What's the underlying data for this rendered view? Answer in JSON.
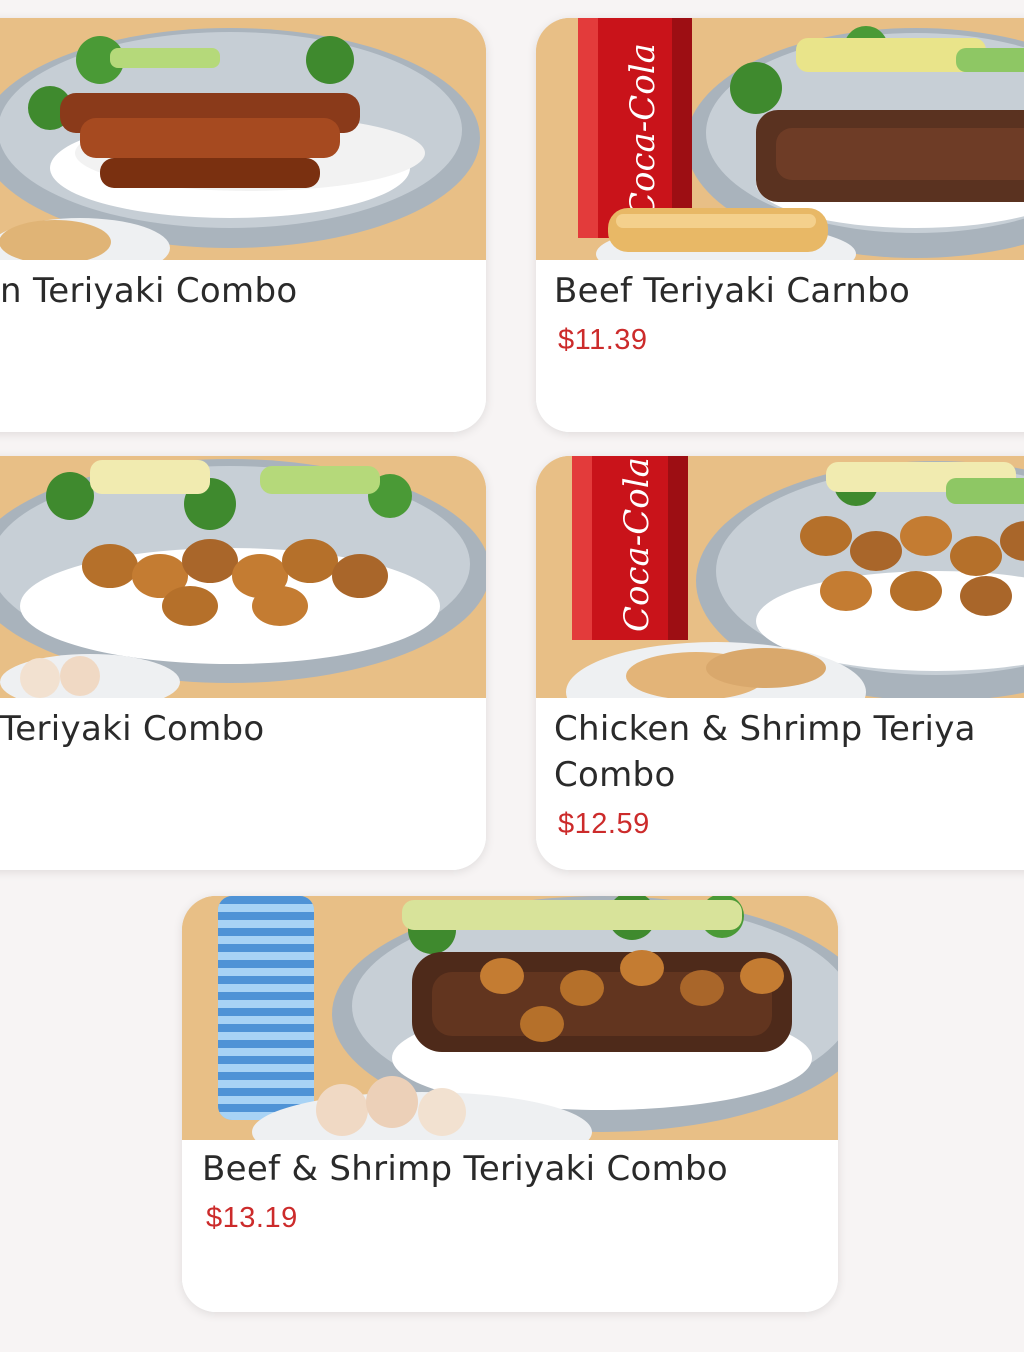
{
  "menu": {
    "items": [
      {
        "name": "n Teriyaki Combo",
        "price": "",
        "image": "chicken-teriyaki-plate",
        "drink": "none",
        "side": "gyoza"
      },
      {
        "name": "Beef Teriyaki Carnbo",
        "price": "$11.39",
        "image": "beef-teriyaki-plate",
        "drink": "coca-cola-can",
        "side": "egg-roll"
      },
      {
        "name": "Teriyaki Combo",
        "price": "",
        "image": "shrimp-teriyaki-plate",
        "drink": "none",
        "side": "shumai"
      },
      {
        "name_line1": "Chicken & Shrimp Teriya",
        "name_line2": "Combo",
        "price": "$12.59",
        "image": "chicken-shrimp-teriyaki-plate",
        "drink": "coca-cola-can",
        "side": "gyoza"
      },
      {
        "name": "Beef & Shrimp Teriyaki Combo",
        "price": "$13.19",
        "image": "beef-shrimp-teriyaki-plate",
        "drink": "water-bottle",
        "side": "shumai"
      }
    ],
    "coke_label": "Coca-Cola"
  },
  "colors": {
    "price": "#cc2b2b",
    "name": "#2a2a2a",
    "background": "#f7f4f4",
    "card": "#ffffff"
  }
}
